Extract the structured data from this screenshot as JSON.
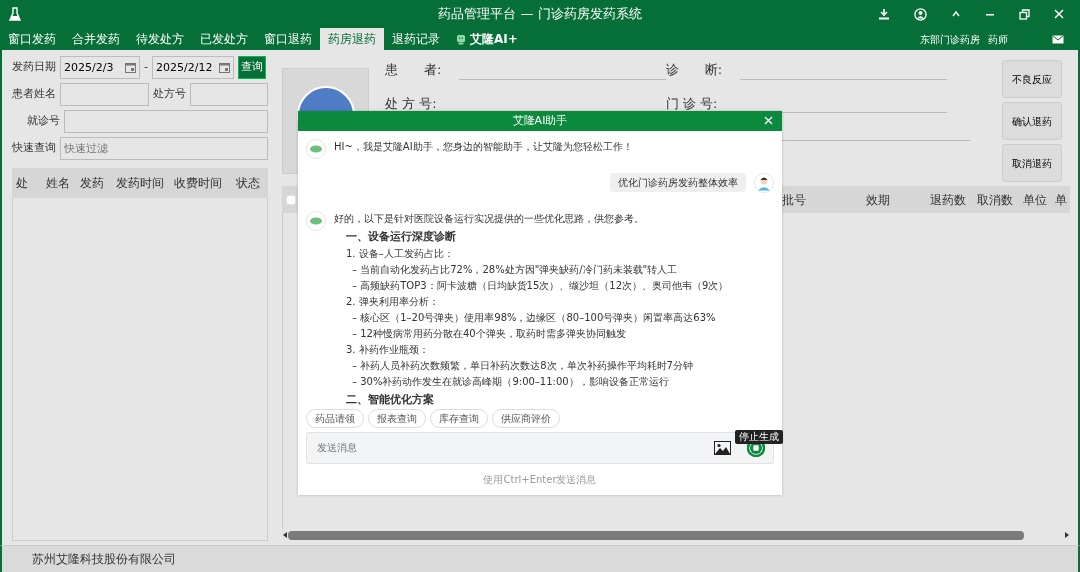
{
  "window": {
    "title": "药品管理平台 — 门诊药房发药系统"
  },
  "tabs": [
    {
      "label": "窗口发药",
      "selected": false,
      "kind": "plain"
    },
    {
      "label": "合并发药",
      "selected": false,
      "kind": "plain"
    },
    {
      "label": "待发处方",
      "selected": false,
      "kind": "plain"
    },
    {
      "label": "已发处方",
      "selected": false,
      "kind": "plain"
    },
    {
      "label": "窗口退药",
      "selected": false,
      "kind": "plain"
    },
    {
      "label": "药房退药",
      "selected": true,
      "kind": "plain"
    },
    {
      "label": "退药记录",
      "selected": false,
      "kind": "plain"
    },
    {
      "label": "艾隆AI+",
      "selected": false,
      "kind": "ai"
    }
  ],
  "user": {
    "department": "东部门诊药房",
    "role": "药师"
  },
  "filters": {
    "date_label": "发药日期",
    "date_from": "2025/2/3",
    "separator": "-",
    "date_to": "2025/2/12",
    "query_button": "查询",
    "patient_name_label": "患者姓名",
    "prescription_label": "处方号",
    "visit_label": "就诊号",
    "quick_label": "快速查询",
    "quick_placeholder": "快速过滤"
  },
  "list": {
    "columns": [
      "处",
      "姓名",
      "发药",
      "发药时间",
      "收费时间",
      "状态"
    ]
  },
  "patient": {
    "fields": [
      {
        "label": "患　　者:"
      },
      {
        "label": "诊　　断:"
      },
      {
        "label": "处 方 号:"
      },
      {
        "label": "门 诊 号:"
      }
    ]
  },
  "actions": [
    "不良反应",
    "确认退药",
    "取消退药"
  ],
  "detail_table": {
    "select_all": {
      "checked": false
    },
    "columns": [
      "批号",
      "效期",
      "退药数",
      "取消数",
      "单位",
      "单"
    ]
  },
  "assistant": {
    "title": "艾隆AI助手",
    "messages": [
      {
        "kind": "bot",
        "blocks": [
          {
            "kind": "intro",
            "text": "HI~，我是艾隆AI助手，您身边的智能助手，让艾隆为您轻松工作！"
          }
        ]
      },
      {
        "kind": "user",
        "text": "优化门诊药房发药整体效率"
      },
      {
        "kind": "bot",
        "blocks": [
          {
            "kind": "intro",
            "text": "好的，以下是针对医院设备运行实况提供的一些优化思路，供您参考。"
          },
          {
            "kind": "heading",
            "text": "一、设备运行深度诊断"
          },
          {
            "kind": "item",
            "text": "1. 设备–人工发药占比："
          },
          {
            "kind": "bullet",
            "text": "– 当前自动化发药占比72%，28%处方因\"弹夹缺药/冷门药未装载\"转人工"
          },
          {
            "kind": "bullet",
            "text": "– 高频缺药TOP3：阿卡波糖（日均缺货15次）、缬沙坦（12次）、奥司他韦（9次）"
          },
          {
            "kind": "item",
            "text": "2. 弹夹利用率分析："
          },
          {
            "kind": "bullet",
            "text": "– 核心区（1–20号弹夹）使用率98%，边缘区（80–100号弹夹）闲置率高达63%"
          },
          {
            "kind": "bullet",
            "text": "– 12种慢病常用药分散在40个弹夹，取药时需多弹夹协同触发"
          },
          {
            "kind": "item",
            "text": "3. 补药作业瓶颈："
          },
          {
            "kind": "bullet",
            "text": "– 补药人员补药次数频繁，单日补药次数达8次，单次补药操作平均耗时7分钟"
          },
          {
            "kind": "bullet",
            "text": "– 30%补药动作发生在就诊高峰期（9:00–11:00），影响设备正常运行"
          },
          {
            "kind": "heading",
            "text": "二、智能优化方案"
          }
        ]
      }
    ],
    "quick_actions": [
      "药品请领",
      "报表查询",
      "库存查询",
      "供应商评价"
    ],
    "input_placeholder": "发送消息",
    "stop_tooltip": "停止生成",
    "hint": "使用Ctrl+Enter发送消息"
  },
  "status_bar": {
    "company": "苏州艾隆科技股份有限公司"
  }
}
